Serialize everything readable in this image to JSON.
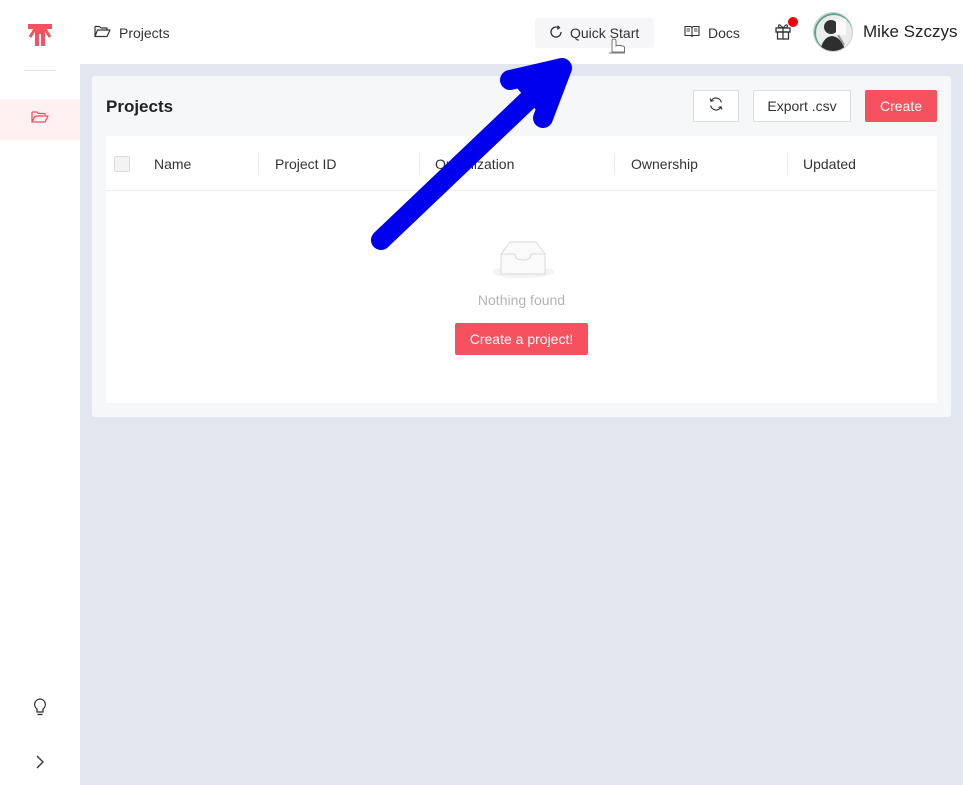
{
  "topbar": {
    "breadcrumb": "Projects",
    "quick_start": "Quick Start",
    "docs": "Docs",
    "username": "Mike Szczys"
  },
  "projects_card": {
    "title": "Projects",
    "export_label": "Export .csv",
    "create_label": "Create",
    "columns": [
      "Name",
      "Project ID",
      "Organization",
      "Ownership",
      "Updated"
    ],
    "empty_text": "Nothing found",
    "create_project_label": "Create a project!"
  },
  "colors": {
    "accent": "#f5515f",
    "notification_dot": "#f00000",
    "annotation_arrow": "#0000ee"
  },
  "icons": {
    "logo": "brand-logo-icon",
    "sidebar_projects": "folder-open-icon",
    "sidebar_tip": "lightbulb-icon",
    "sidebar_expand": "chevron-right-icon",
    "breadcrumb": "folder-open-icon",
    "quick_start": "refresh-icon",
    "docs": "book-icon",
    "gift": "gift-icon",
    "refresh_button": "refresh-icon",
    "empty_state": "inbox-icon"
  }
}
